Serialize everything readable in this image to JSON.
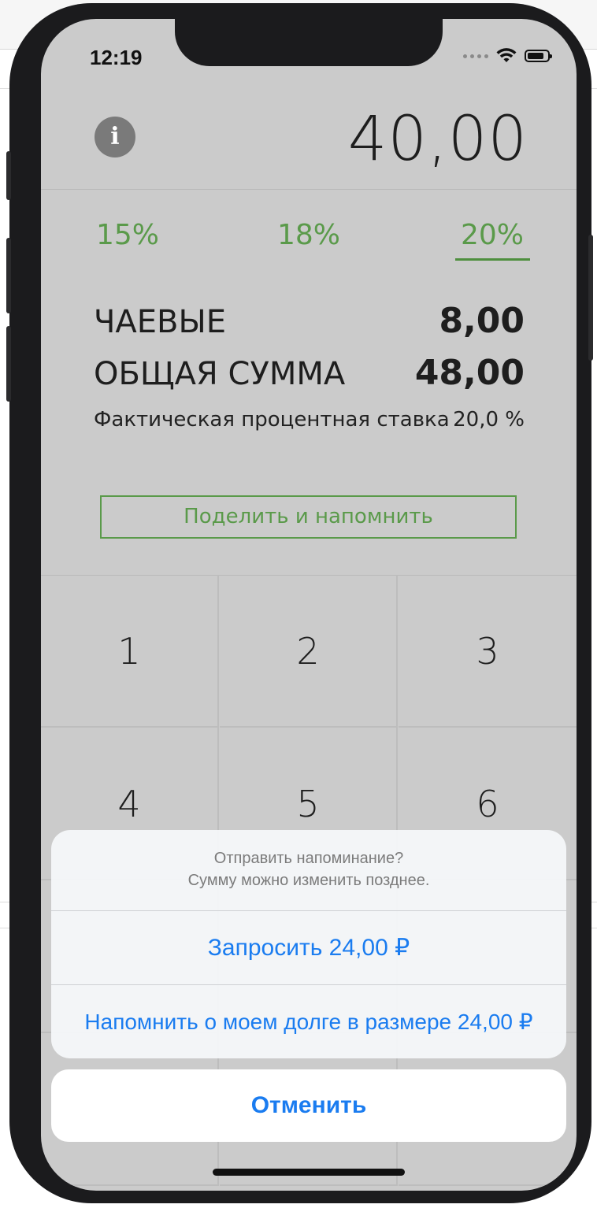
{
  "status_bar": {
    "time": "12:19"
  },
  "header": {
    "info_icon": "info-icon",
    "bill_amount": "40,00"
  },
  "tip_options": [
    {
      "label": "15%",
      "selected": false
    },
    {
      "label": "18%",
      "selected": false
    },
    {
      "label": "20%",
      "selected": true
    }
  ],
  "summary": {
    "tip_label": "ЧАЕВЫЕ",
    "tip_value": "8,00",
    "total_label": "ОБЩАЯ СУММА",
    "total_value": "48,00",
    "effective_rate_label": "Фактическая процентная ставка",
    "effective_rate_value": "20,0 %"
  },
  "split_button": {
    "label": "Поделить и напомнить"
  },
  "keypad": {
    "keys": [
      "1",
      "2",
      "3",
      "4",
      "5",
      "6"
    ]
  },
  "action_sheet": {
    "title": "Отправить напоминание?",
    "message": "Сумму можно изменить позднее.",
    "request_label": "Запросить 24,00 ₽",
    "remind_debt_label": "Напомнить о моем долге в размере 24,00 ₽",
    "cancel_label": "Отменить"
  },
  "colors": {
    "accent_green": "#5a9a4a",
    "ios_blue": "#1a7cf0",
    "screen_bg": "#cbcbcb"
  }
}
